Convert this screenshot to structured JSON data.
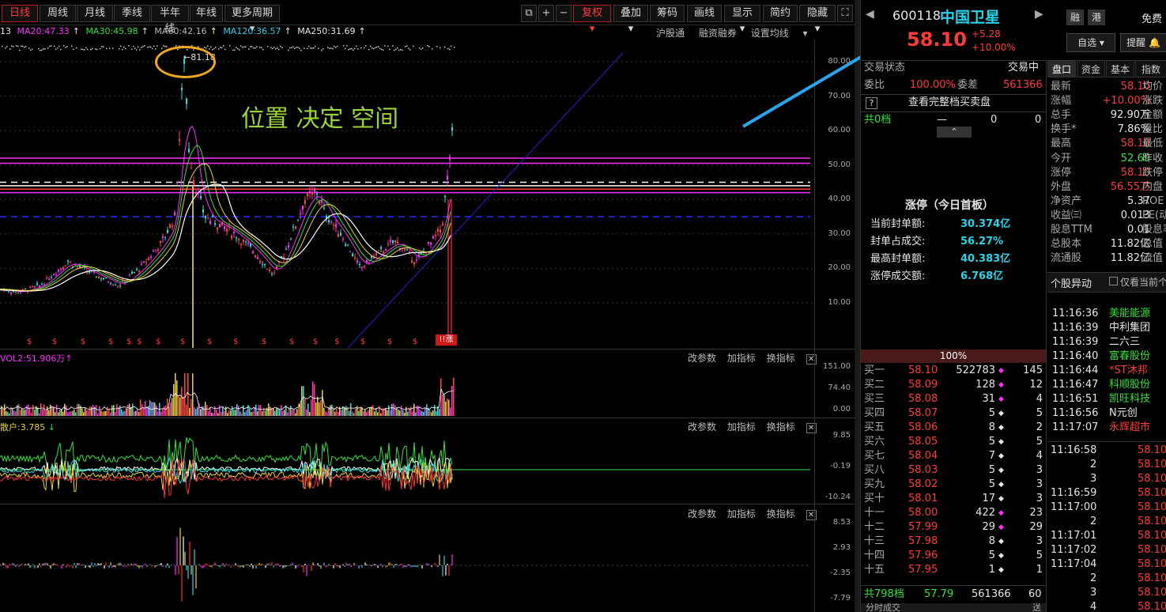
{
  "toolbar": {
    "periods": [
      "日线",
      "周线",
      "月线",
      "季线",
      "半年线",
      "年线"
    ],
    "more_periods": "更多周期",
    "icons": [
      "⧉",
      "+",
      "−"
    ],
    "fuquan": "复权",
    "buttons": [
      "叠加",
      "筹码",
      "画线",
      "显示",
      "简约",
      "隐藏"
    ]
  },
  "ma": {
    "m13": "13",
    "ma20": "MA20:47.33",
    "ma30": "MA30:45.98",
    "ma60": "MA60:42.16",
    "ma120": "MA120:36.57",
    "ma250": "MA250:31.69"
  },
  "links": [
    "沪股通",
    "融资融券",
    "设置均线"
  ],
  "main_chart": {
    "y_ticks": [
      "80.00",
      "70.00",
      "60.00",
      "50.00",
      "40.00",
      "30.00",
      "20.00",
      "10.00"
    ],
    "peak_label": "81.18",
    "annotation": "位置 决定 空间",
    "limit_badge": "涨"
  },
  "vol_panel": {
    "label": "VOL2:51.906万",
    "y_ticks": [
      "151.00",
      "74.40",
      "0.00"
    ]
  },
  "ind1_panel": {
    "label": "散户:3.785",
    "y_ticks": [
      "9.85",
      "-0.19",
      "-10.24"
    ]
  },
  "ind2_panel": {
    "y_ticks": [
      "8.53",
      "2.93",
      "-2.35",
      "-7.79"
    ]
  },
  "panel_tools": [
    "改参数",
    "加指标",
    "换指标"
  ],
  "colors": {
    "up": "#ff3a3a",
    "down": "#35e13b",
    "ma20": "#ff30ff",
    "ma30": "#35e13b",
    "ma60": "#cccccc",
    "ma120": "#29d4e8",
    "ma250": "#ffffff"
  },
  "quote": {
    "code": "600118",
    "name": "中国卫星",
    "tag1": "融",
    "tag2": "港",
    "free": "免费",
    "price": "58.10",
    "change": "+5.28",
    "change_pct": "+10.00%",
    "self_select": "自选",
    "remind": "提醒",
    "status_label": "交易状态",
    "status_value": "交易中",
    "weibi_label": "委比",
    "weibi_value": "100.00%",
    "weicha_label": "委差",
    "weicha_value": "561366",
    "full_book": "查看完整档买卖盘",
    "sell_levels_label": "共0档",
    "sell_levels_dash": "—",
    "sell_levels_v1": "0",
    "sell_levels_v2": "0",
    "limit_title": "涨停（今日首板）",
    "limit_rows": [
      {
        "k": "当前封单额:",
        "v": "30.374亿"
      },
      {
        "k": "封单占成交:",
        "v": "56.27%"
      },
      {
        "k": "最高封单额:",
        "v": "40.383亿"
      },
      {
        "k": "涨停成交额:",
        "v": "6.768亿"
      }
    ],
    "bar_pct": "100%",
    "buy_book": [
      {
        "lvl": "买一",
        "p": "58.10",
        "v": "522783",
        "n": "145"
      },
      {
        "lvl": "买二",
        "p": "58.09",
        "v": "128",
        "n": "12"
      },
      {
        "lvl": "买三",
        "p": "58.08",
        "v": "31",
        "n": "4"
      },
      {
        "lvl": "买四",
        "p": "58.07",
        "v": "5",
        "n": "5"
      },
      {
        "lvl": "买五",
        "p": "58.06",
        "v": "8",
        "n": "2"
      },
      {
        "lvl": "买六",
        "p": "58.05",
        "v": "5",
        "n": "5"
      },
      {
        "lvl": "买七",
        "p": "58.04",
        "v": "7",
        "n": "4"
      },
      {
        "lvl": "买八",
        "p": "58.03",
        "v": "5",
        "n": "3"
      },
      {
        "lvl": "买九",
        "p": "58.02",
        "v": "5",
        "n": "3"
      },
      {
        "lvl": "买十",
        "p": "58.01",
        "v": "17",
        "n": "3"
      },
      {
        "lvl": "十一",
        "p": "58.00",
        "v": "422",
        "n": "23"
      },
      {
        "lvl": "十二",
        "p": "57.99",
        "v": "29",
        "n": "29"
      },
      {
        "lvl": "十三",
        "p": "57.98",
        "v": "8",
        "n": "3"
      },
      {
        "lvl": "十四",
        "p": "57.96",
        "v": "5",
        "n": "5"
      },
      {
        "lvl": "十五",
        "p": "57.95",
        "v": "1",
        "n": "1"
      }
    ],
    "total_levels": {
      "lvl": "共798档",
      "p": "57.79",
      "v": "561366",
      "n": "60"
    },
    "tabs": [
      "盘口",
      "资金",
      "基本",
      "指数"
    ],
    "stats": [
      {
        "k": "最新",
        "v": "58.10",
        "k2": "均价"
      },
      {
        "k": "涨幅",
        "v": "+10.00%",
        "k2": "涨跌"
      },
      {
        "k": "总手",
        "v": "92.90万",
        "k2": "金额"
      },
      {
        "k": "换手*",
        "v": "7.86%",
        "k2": "量比"
      },
      {
        "k": "最高",
        "v": "58.10",
        "k2": "最低"
      },
      {
        "k": "今开",
        "v": "52.69",
        "k2": "昨收"
      },
      {
        "k": "涨停",
        "v": "58.10",
        "k2": "跌停"
      },
      {
        "k": "外盘",
        "v": "56.55万",
        "k2": "内盘"
      },
      {
        "k": "净资产",
        "v": "5.37",
        "k2": "ROE"
      },
      {
        "k": "收益㈢",
        "v": "0.013",
        "k2": "PE(动)"
      },
      {
        "k": "股息TTM",
        "v": "0.01",
        "k2": "股息率"
      },
      {
        "k": "总股本",
        "v": "11.82亿",
        "k2": "总值"
      },
      {
        "k": "流通股",
        "v": "11.82亿",
        "k2": "流值"
      }
    ],
    "movement_title": "个股异动",
    "movement_check": "仅看当前个股",
    "movements": [
      {
        "t": "11:16:36",
        "n": "美能能源",
        "c": "green"
      },
      {
        "t": "11:16:39",
        "n": "中利集团",
        "c": "white"
      },
      {
        "t": "11:16:39",
        "n": "二六三",
        "c": "white"
      },
      {
        "t": "11:16:40",
        "n": "富春股份",
        "c": "green"
      },
      {
        "t": "11:16:44",
        "n": "*ST沐邦",
        "c": "red"
      },
      {
        "t": "11:16:47",
        "n": "科顺股份",
        "c": "green"
      },
      {
        "t": "11:16:51",
        "n": "凯旺科技",
        "c": "green"
      },
      {
        "t": "11:16:56",
        "n": "N元创",
        "c": "white"
      },
      {
        "t": "11:17:07",
        "n": "永辉超市",
        "c": "red"
      }
    ],
    "ticks": [
      {
        "t": "11:16:58",
        "p": "58.10"
      },
      {
        "t": "2",
        "p": "58.10"
      },
      {
        "t": "3",
        "p": "58.10"
      },
      {
        "t": "11:16:59",
        "p": "58.10"
      },
      {
        "t": "11:17:00",
        "p": "58.10"
      },
      {
        "t": "2",
        "p": "58.10"
      },
      {
        "t": "11:17:01",
        "p": "58.10"
      },
      {
        "t": "11:17:02",
        "p": "58.10"
      },
      {
        "t": "11:17:04",
        "p": "58.10"
      },
      {
        "t": "2",
        "p": "58.10"
      },
      {
        "t": "3",
        "p": "58.10"
      },
      {
        "t": "4",
        "p": "58.10"
      }
    ],
    "fenshi": "分时成交",
    "fenshi_more": "送"
  }
}
